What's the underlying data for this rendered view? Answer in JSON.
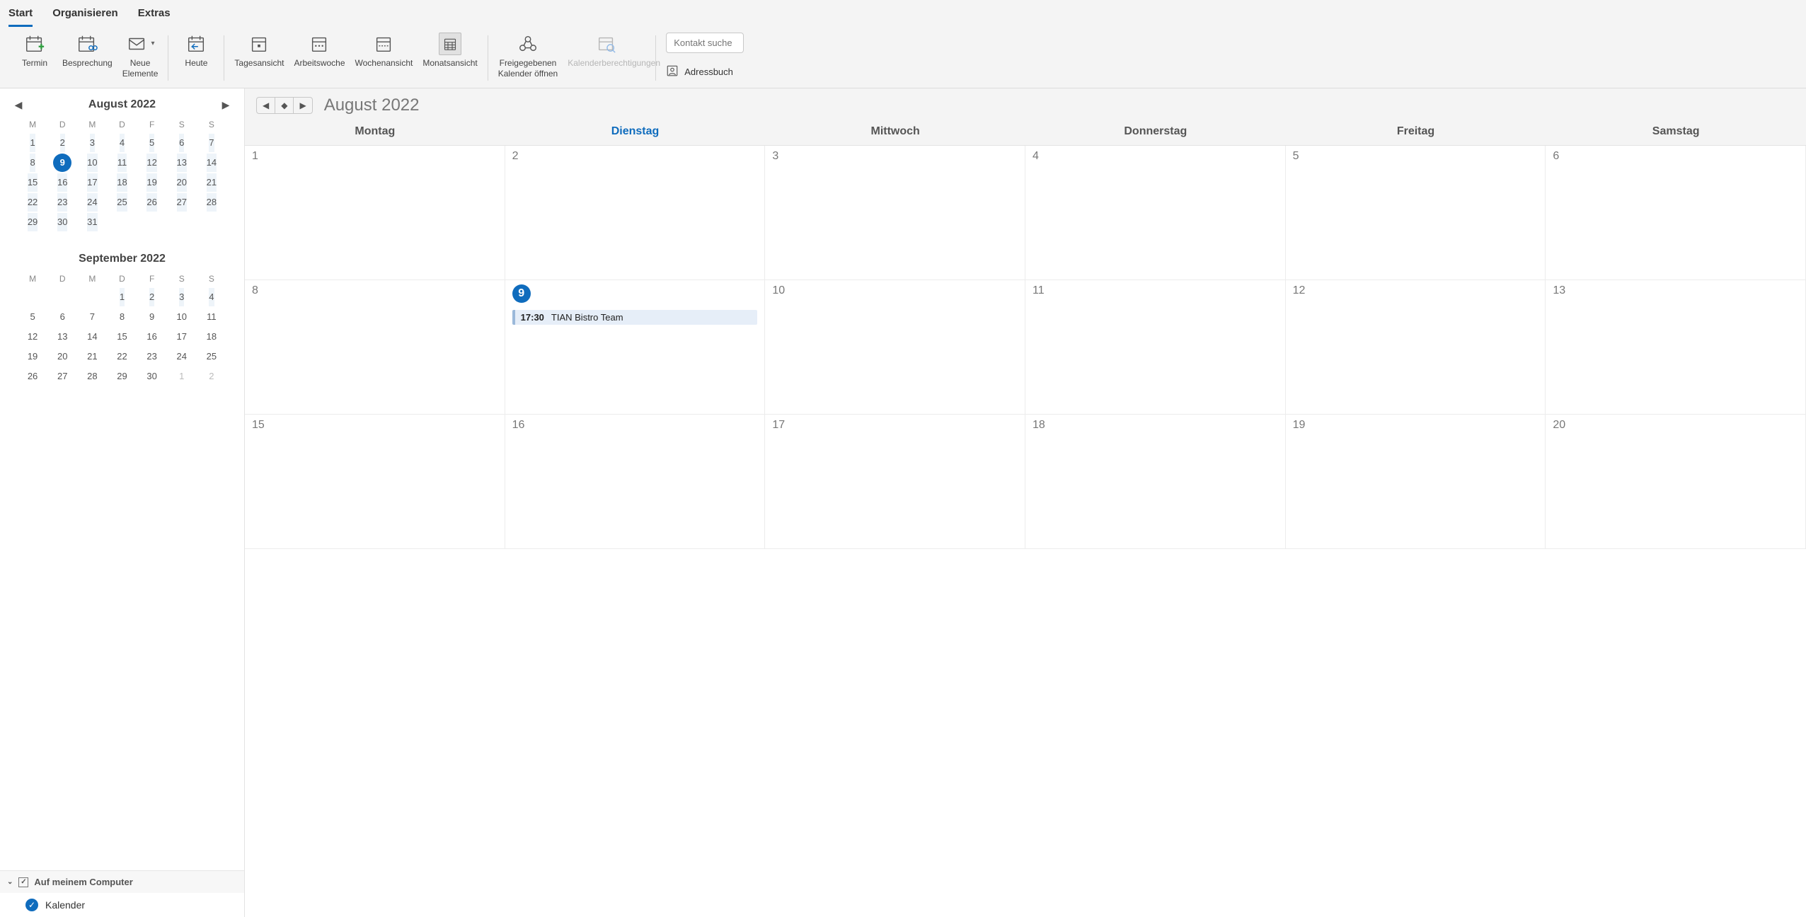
{
  "menu": {
    "tabs": [
      "Start",
      "Organisieren",
      "Extras"
    ],
    "active": 0
  },
  "ribbon": {
    "termin": "Termin",
    "besprechung": "Besprechung",
    "neue_elemente": "Neue\nElemente",
    "heute": "Heute",
    "tagesansicht": "Tagesansicht",
    "arbeitswoche": "Arbeitswoche",
    "wochenansicht": "Wochenansicht",
    "monatsansicht": "Monatsansicht",
    "freigegebenen": "Freigegebenen\nKalender öffnen",
    "berechtigungen": "Kalenderberechtigungen",
    "search_placeholder": "Kontakt suche",
    "adressbuch": "Adressbuch"
  },
  "mini": {
    "m1": {
      "title": "August 2022",
      "dow": [
        "M",
        "D",
        "M",
        "D",
        "F",
        "S",
        "S"
      ],
      "cells": [
        {
          "d": 1,
          "hl": true
        },
        {
          "d": 2,
          "hl": true
        },
        {
          "d": 3,
          "hl": true
        },
        {
          "d": 4,
          "hl": true
        },
        {
          "d": 5,
          "hl": true
        },
        {
          "d": 6,
          "hl": true
        },
        {
          "d": 7,
          "hl": true
        },
        {
          "d": 8,
          "hl": true
        },
        {
          "d": 9,
          "today": true
        },
        {
          "d": 10,
          "hl": true
        },
        {
          "d": 11,
          "hl": true
        },
        {
          "d": 12,
          "hl": true
        },
        {
          "d": 13,
          "hl": true
        },
        {
          "d": 14,
          "hl": true
        },
        {
          "d": 15,
          "hl": true
        },
        {
          "d": 16,
          "hl": true
        },
        {
          "d": 17,
          "hl": true
        },
        {
          "d": 18,
          "hl": true
        },
        {
          "d": 19,
          "hl": true
        },
        {
          "d": 20,
          "hl": true
        },
        {
          "d": 21,
          "hl": true
        },
        {
          "d": 22,
          "hl": true
        },
        {
          "d": 23,
          "hl": true
        },
        {
          "d": 24,
          "hl": true
        },
        {
          "d": 25,
          "hl": true
        },
        {
          "d": 26,
          "hl": true
        },
        {
          "d": 27,
          "hl": true
        },
        {
          "d": 28,
          "hl": true
        },
        {
          "d": 29,
          "hl": true
        },
        {
          "d": 30,
          "hl": true
        },
        {
          "d": 31,
          "hl": true
        },
        {
          "d": "",
          "dim": true
        },
        {
          "d": "",
          "dim": true
        },
        {
          "d": "",
          "dim": true
        },
        {
          "d": "",
          "dim": true
        }
      ]
    },
    "m2": {
      "title": "September 2022",
      "dow": [
        "M",
        "D",
        "M",
        "D",
        "F",
        "S",
        "S"
      ],
      "cells": [
        {
          "d": "",
          "dim": true
        },
        {
          "d": "",
          "dim": true
        },
        {
          "d": "",
          "dim": true
        },
        {
          "d": 1,
          "hl": true
        },
        {
          "d": 2,
          "hl": true
        },
        {
          "d": 3,
          "hl": true
        },
        {
          "d": 4,
          "hl": true
        },
        {
          "d": 5
        },
        {
          "d": 6
        },
        {
          "d": 7
        },
        {
          "d": 8
        },
        {
          "d": 9
        },
        {
          "d": 10
        },
        {
          "d": 11
        },
        {
          "d": 12
        },
        {
          "d": 13
        },
        {
          "d": 14
        },
        {
          "d": 15
        },
        {
          "d": 16
        },
        {
          "d": 17
        },
        {
          "d": 18
        },
        {
          "d": 19
        },
        {
          "d": 20
        },
        {
          "d": 21
        },
        {
          "d": 22
        },
        {
          "d": 23
        },
        {
          "d": 24
        },
        {
          "d": 25
        },
        {
          "d": 26
        },
        {
          "d": 27
        },
        {
          "d": 28
        },
        {
          "d": 29
        },
        {
          "d": 30
        },
        {
          "d": 1,
          "dim": true
        },
        {
          "d": 2,
          "dim": true
        }
      ]
    }
  },
  "cal_list": {
    "group": "Auf meinem Computer",
    "items": [
      {
        "name": "Kalender",
        "checked": true
      }
    ]
  },
  "header": {
    "title": "August 2022",
    "dow": [
      "Montag",
      "Dienstag",
      "Mittwoch",
      "Donnerstag",
      "Freitag",
      "Samstag"
    ],
    "today_index": 1
  },
  "grid": {
    "weeks": [
      [
        {
          "n": 1
        },
        {
          "n": 2
        },
        {
          "n": 3
        },
        {
          "n": 4
        },
        {
          "n": 5
        },
        {
          "n": 6
        }
      ],
      [
        {
          "n": 8
        },
        {
          "n": 9,
          "today": true,
          "events": [
            {
              "time": "17:30",
              "title": "TIAN Bistro Team"
            }
          ]
        },
        {
          "n": 10
        },
        {
          "n": 11
        },
        {
          "n": 12
        },
        {
          "n": 13
        }
      ],
      [
        {
          "n": 15
        },
        {
          "n": 16
        },
        {
          "n": 17
        },
        {
          "n": 18
        },
        {
          "n": 19
        },
        {
          "n": 20
        }
      ]
    ]
  }
}
